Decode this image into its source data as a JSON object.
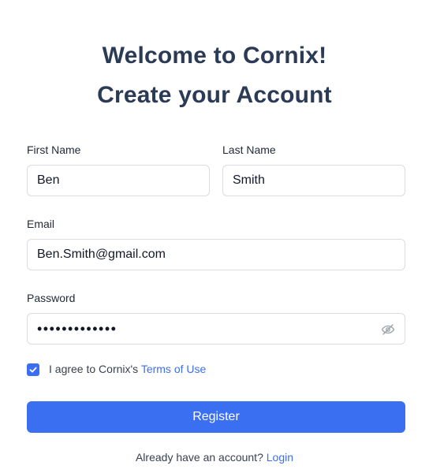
{
  "header": {
    "welcome": "Welcome to Cornix!",
    "subtitle": "Create your Account"
  },
  "form": {
    "first_name": {
      "label": "First Name",
      "value": "Ben"
    },
    "last_name": {
      "label": "Last Name",
      "value": "Smith"
    },
    "email": {
      "label": "Email",
      "value": "Ben.Smith@gmail.com"
    },
    "password": {
      "label": "Password",
      "masked_value": "•••••••••••••"
    },
    "terms": {
      "checked": true,
      "text": "I agree to Cornix's",
      "link_label": "Terms of Use"
    },
    "register_label": "Register"
  },
  "footer": {
    "text": "Already have an account?",
    "login_label": "Login"
  },
  "colors": {
    "accent": "#3b6ff2",
    "heading": "#2b3a55"
  },
  "icons": {
    "password_toggle": "eye-off-icon",
    "checkbox_check": "checkmark-icon"
  }
}
